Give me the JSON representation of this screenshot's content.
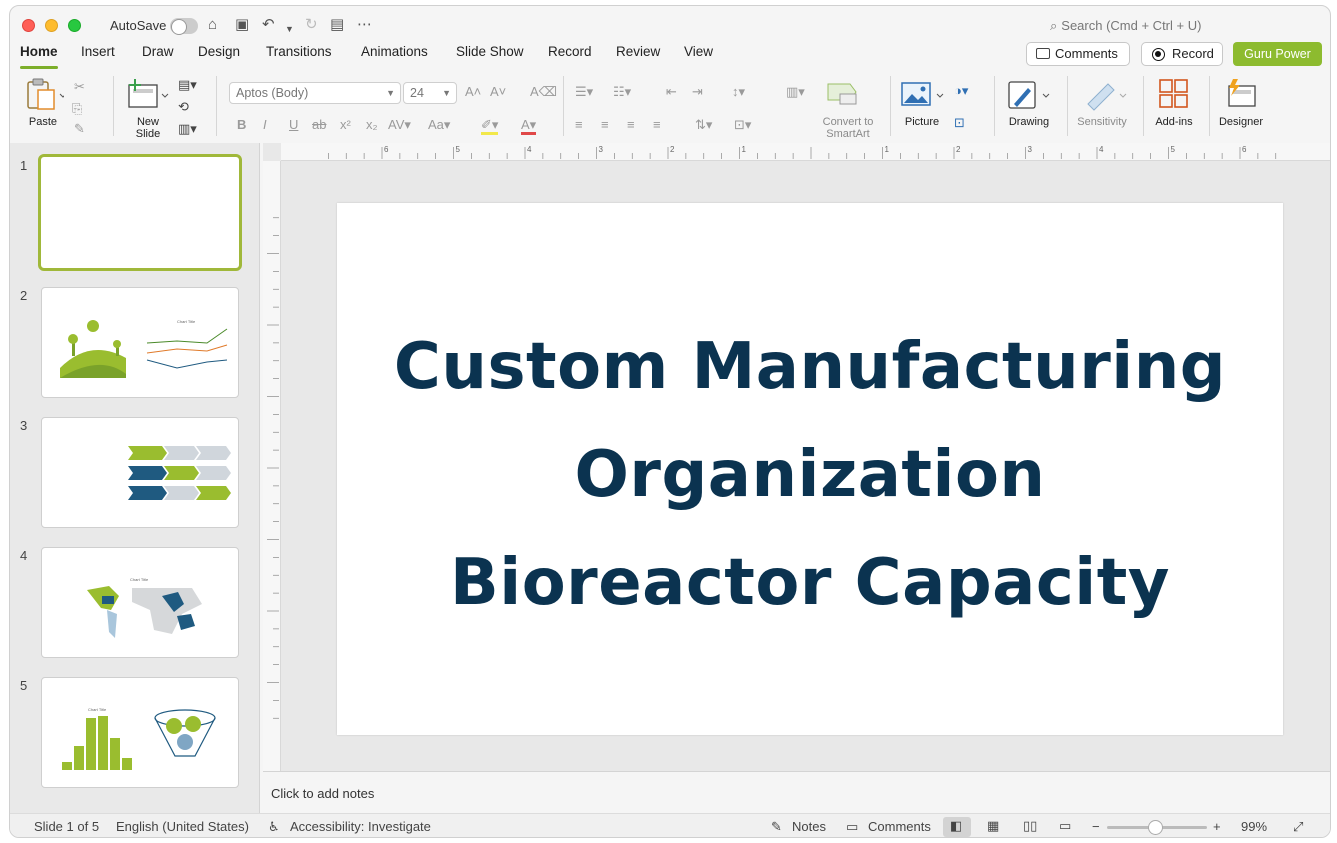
{
  "titlebar": {
    "autosave_label": "AutoSave",
    "search_placeholder": "Search (Cmd + Ctrl + U)"
  },
  "tabs": [
    {
      "label": "Home",
      "active": true
    },
    {
      "label": "Insert"
    },
    {
      "label": "Draw"
    },
    {
      "label": "Design"
    },
    {
      "label": "Transitions"
    },
    {
      "label": "Animations"
    },
    {
      "label": "Slide Show"
    },
    {
      "label": "Record"
    },
    {
      "label": "Review"
    },
    {
      "label": "View"
    }
  ],
  "header_buttons": {
    "comments": "Comments",
    "record": "Record",
    "guru": "Guru Power"
  },
  "ribbon": {
    "paste": "Paste",
    "new_slide": "New\nSlide",
    "font_name": "Aptos (Body)",
    "font_size": "24",
    "convert_smartart": "Convert to\nSmartArt",
    "picture": "Picture",
    "drawing": "Drawing",
    "sensitivity": "Sensitivity",
    "addins": "Add-ins",
    "designer": "Designer"
  },
  "thumbnails": [
    {
      "number": "1",
      "selected": true
    },
    {
      "number": "2"
    },
    {
      "number": "3"
    },
    {
      "number": "4"
    },
    {
      "number": "5"
    }
  ],
  "slide": {
    "title_lines": [
      "Custom Manufacturing",
      "Organization",
      "Bioreactor Capacity"
    ]
  },
  "notes_placeholder": "Click to add notes",
  "status": {
    "slide_of": "Slide 1 of 5",
    "language": "English (United States)",
    "accessibility": "Accessibility: Investigate",
    "notes": "Notes",
    "comments": "Comments",
    "zoom": "99%"
  },
  "colors": {
    "accent_green": "#8dbb2f",
    "title_navy": "#0b3350",
    "chevron_blue": "#1f5a80"
  }
}
